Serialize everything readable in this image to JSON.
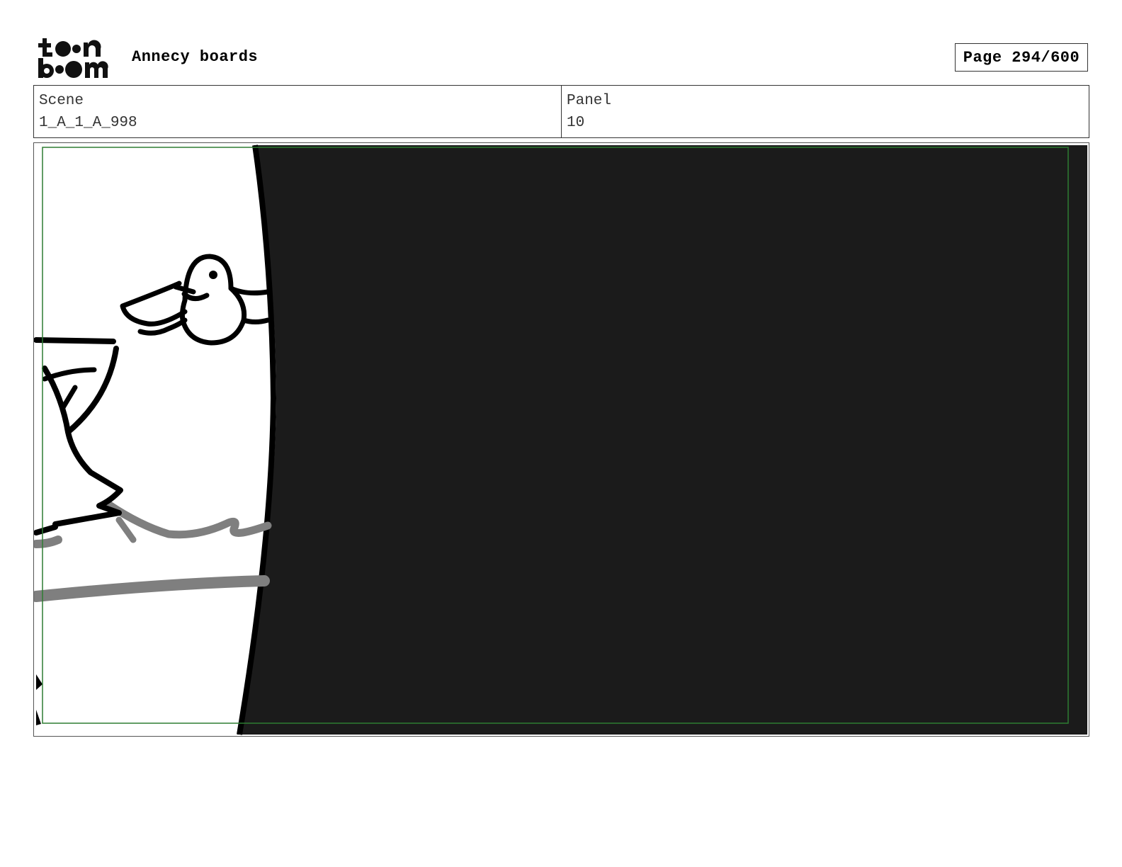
{
  "header": {
    "logo_text": "toon boom",
    "title": "Annecy boards",
    "page_label": "Page 294/600"
  },
  "info": {
    "scene_label": "Scene",
    "scene_value": "1_A_1_A_998",
    "panel_label": "Panel",
    "panel_value": "10"
  },
  "panel": {
    "safe_frame_color": "#2e7d32",
    "dark_fill_color": "#1b1b1b"
  }
}
